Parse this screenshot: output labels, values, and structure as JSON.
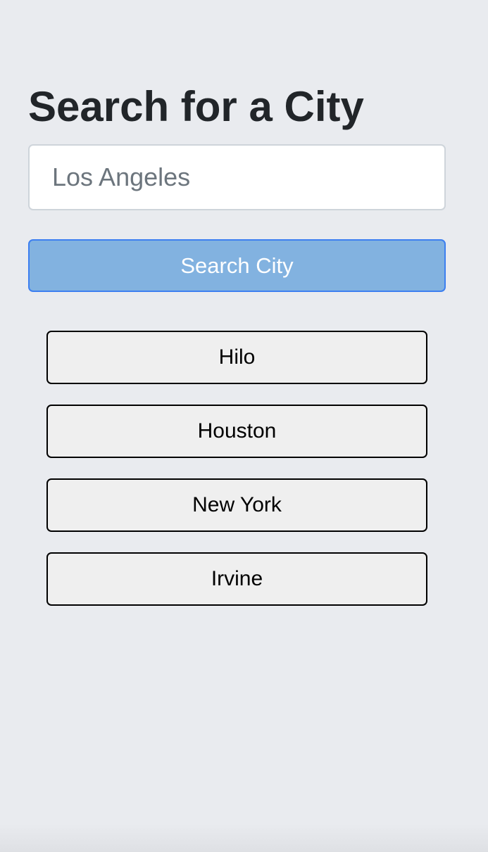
{
  "heading": "Search for a City",
  "search": {
    "placeholder": "Los Angeles",
    "value": ""
  },
  "search_button_label": "Search City",
  "cities": [
    {
      "label": "Hilo"
    },
    {
      "label": "Houston"
    },
    {
      "label": "New York"
    },
    {
      "label": "Irvine"
    }
  ],
  "colors": {
    "background": "#e9ebef",
    "search_button_bg": "#82b2e0",
    "search_button_border": "#3d7ff0",
    "city_button_bg": "#efefef"
  }
}
